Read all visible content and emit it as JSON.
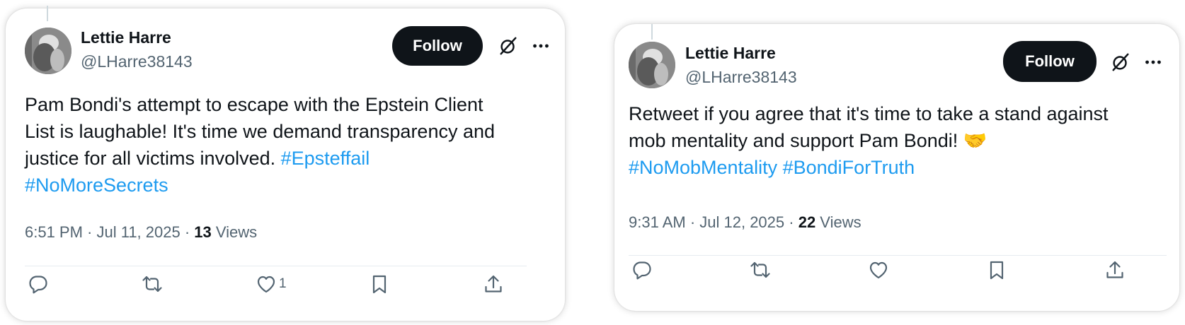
{
  "tweets": [
    {
      "user": {
        "name": "Lettie Harre",
        "handle": "@LHarre38143"
      },
      "follow_label": "Follow",
      "text_lines": [
        "Pam Bondi's attempt to escape with the Epstein Client",
        "List is laughable! It's time we demand transparency and",
        "justice for all victims involved. "
      ],
      "hashtags": [
        "#Epsteffail",
        "#NoMoreSecrets"
      ],
      "emoji": "",
      "timestamp": "6:51 PM · Jul 11, 2025 · ",
      "views_count": "13",
      "views_label": " Views",
      "actions": {
        "reply_count": "",
        "retweet_count": "",
        "like_count": "1"
      }
    },
    {
      "user": {
        "name": "Lettie Harre",
        "handle": "@LHarre38143"
      },
      "follow_label": "Follow",
      "text_lines": [
        "Retweet if you agree that it's time to take a stand against",
        "mob mentality and support Pam Bondi! "
      ],
      "hashtags": [
        "#NoMobMentality",
        "#BondiForTruth"
      ],
      "emoji": "🤝",
      "timestamp": "9:31 AM · Jul 12, 2025 · ",
      "views_count": "22",
      "views_label": " Views",
      "actions": {
        "reply_count": "",
        "retweet_count": "",
        "like_count": ""
      }
    }
  ],
  "icons": {
    "grok": "grok-icon",
    "more": "more-icon",
    "reply": "reply-icon",
    "retweet": "retweet-icon",
    "like": "heart-icon",
    "bookmark": "bookmark-icon",
    "share": "share-icon"
  },
  "colors": {
    "hashtag": "#1d9bf0",
    "follow_bg": "#0f1419",
    "secondary_text": "#536471"
  }
}
